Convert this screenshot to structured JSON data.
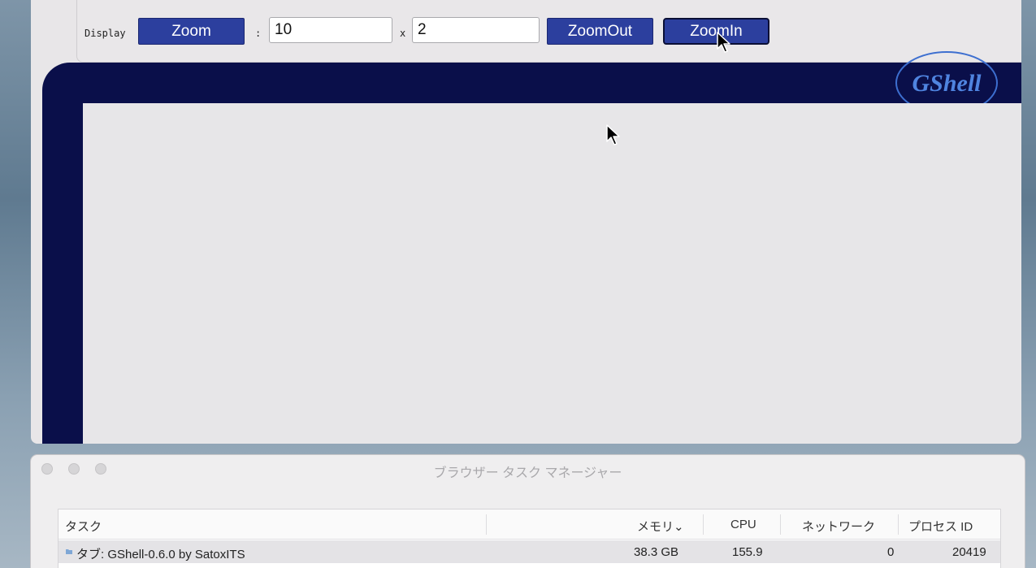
{
  "toolbar": {
    "display_label": "Display",
    "zoom_label": "Zoom",
    "colon": ":",
    "width_value": "10",
    "times": "x",
    "height_value": "2",
    "zoomout_label": "ZoomOut",
    "zoomin_label": "ZoomIn"
  },
  "gshell": {
    "logo_text": "GShell",
    "frame_color": "#0a0f4a",
    "button_color": "#2c3f9e"
  },
  "task_manager": {
    "title": "ブラウザー タスク マネージャー",
    "columns": {
      "task": "タスク",
      "memory": "メモリ",
      "cpu": "CPU",
      "network": "ネットワーク",
      "pid": "プロセス ID"
    },
    "sort_indicator": "⌄",
    "rows": [
      {
        "task": "タブ: GShell-0.6.0 by SatoxITS",
        "memory": "38.3 GB",
        "cpu": "155.9",
        "network": "0",
        "pid": "20419"
      }
    ]
  }
}
